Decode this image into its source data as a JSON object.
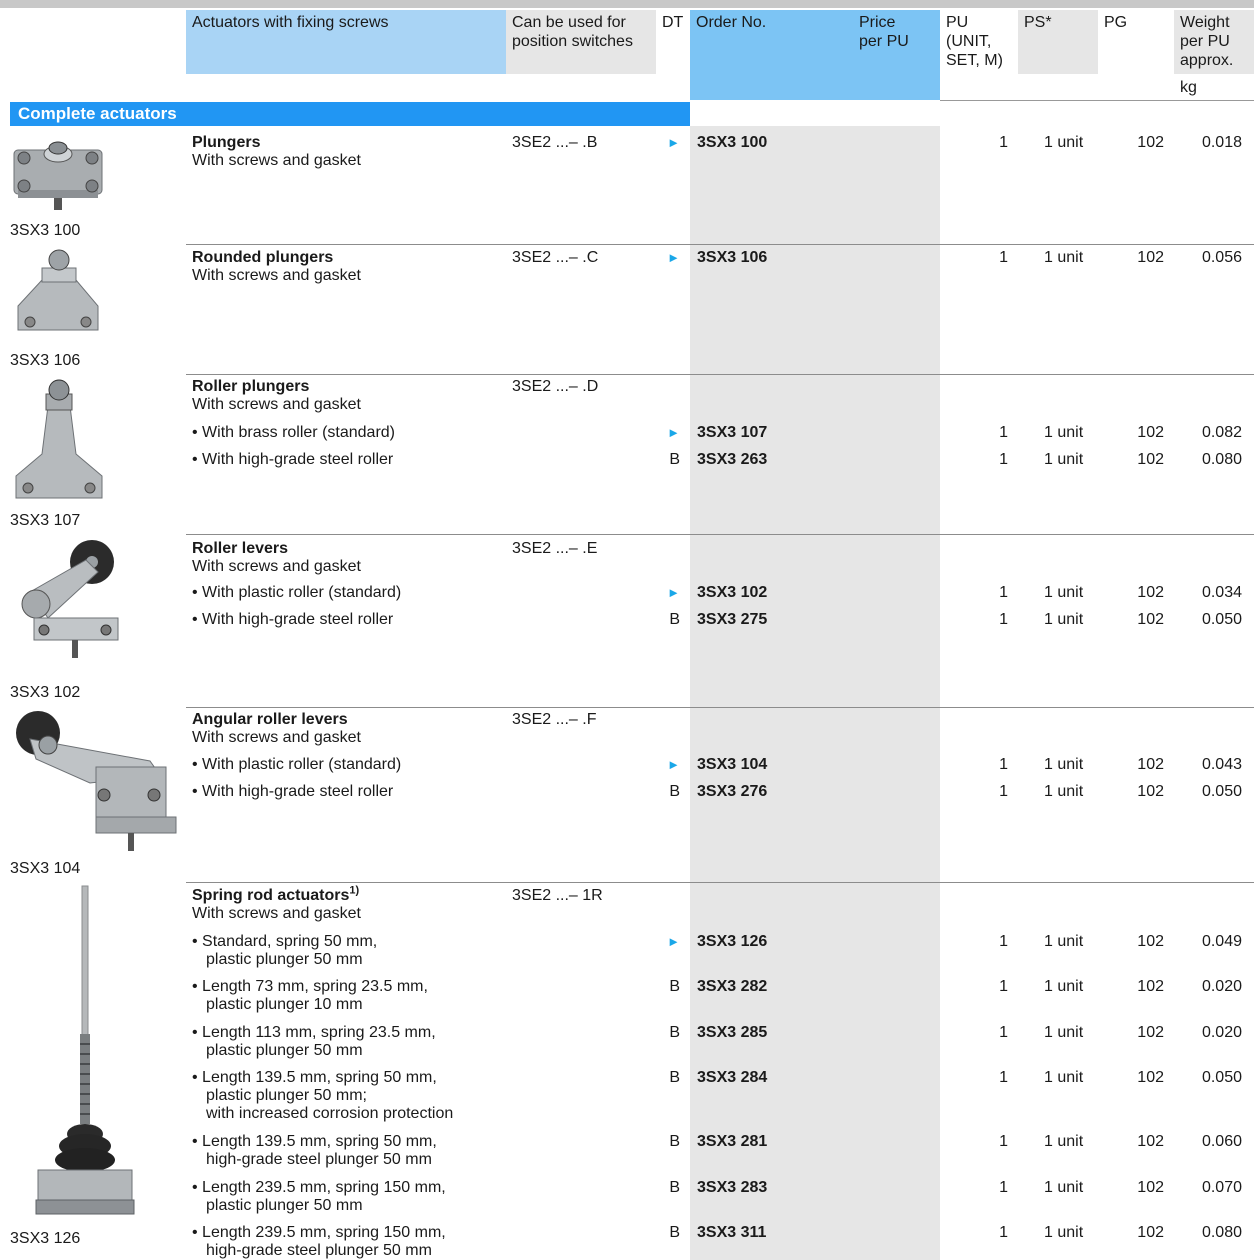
{
  "header": {
    "description": "Actuators with fixing screws",
    "can_be_used": "Can be used for\nposition switches",
    "dt": "DT",
    "order_no": "Order No.",
    "price": "Price\nper PU",
    "pu": "PU\n(UNIT,\nSET, M)",
    "ps": "PS*",
    "pg": "PG",
    "weight": "Weight\nper PU\napprox.",
    "weight_unit": "kg"
  },
  "section_title": "Complete actuators",
  "colors": {
    "header_blue": "#a9d4f5",
    "order_blue": "#7cc4f4",
    "section_blue": "#2196f3",
    "gray": "#e6e6e6",
    "triangle": "#1aa7e8"
  },
  "groups": [
    {
      "title": "Plungers",
      "subtitle": "With screws and gasket",
      "switch": "3SE2 ...– .B",
      "image_label": "3SX3 100",
      "image_icon": "plunger-actuator-icon",
      "items": [
        {
          "desc": "",
          "dt": "►",
          "order": "3SX3 100",
          "pu": "1",
          "ps": "1 unit",
          "pg": "102",
          "weight": "0.018"
        }
      ]
    },
    {
      "title": "Rounded plungers",
      "subtitle": "With screws and gasket",
      "switch": "3SE2 ...– .C",
      "image_label": "3SX3 106",
      "image_icon": "rounded-plunger-icon",
      "items": [
        {
          "desc": "",
          "dt": "►",
          "order": "3SX3 106",
          "pu": "1",
          "ps": "1 unit",
          "pg": "102",
          "weight": "0.056"
        }
      ]
    },
    {
      "title": "Roller plungers",
      "subtitle": "With screws and gasket",
      "switch": "3SE2 ...– .D",
      "image_label": "3SX3 107",
      "image_icon": "roller-plunger-icon",
      "items": [
        {
          "desc": "• With brass roller (standard)",
          "dt": "►",
          "order": "3SX3 107",
          "pu": "1",
          "ps": "1 unit",
          "pg": "102",
          "weight": "0.082"
        },
        {
          "desc": "• With high-grade steel roller",
          "dt": "B",
          "order": "3SX3 263",
          "pu": "1",
          "ps": "1 unit",
          "pg": "102",
          "weight": "0.080"
        }
      ]
    },
    {
      "title": "Roller levers",
      "subtitle": "With screws and gasket",
      "switch": "3SE2 ...– .E",
      "image_label": "3SX3 102",
      "image_icon": "roller-lever-icon",
      "items": [
        {
          "desc": "• With plastic roller (standard)",
          "dt": "►",
          "order": "3SX3 102",
          "pu": "1",
          "ps": "1 unit",
          "pg": "102",
          "weight": "0.034"
        },
        {
          "desc": "• With high-grade steel roller",
          "dt": "B",
          "order": "3SX3 275",
          "pu": "1",
          "ps": "1 unit",
          "pg": "102",
          "weight": "0.050"
        }
      ]
    },
    {
      "title": "Angular roller levers",
      "subtitle": "With screws and gasket",
      "switch": "3SE2 ...– .F",
      "image_label": "3SX3 104",
      "image_icon": "angular-roller-lever-icon",
      "items": [
        {
          "desc": "• With plastic roller (standard)",
          "dt": "►",
          "order": "3SX3 104",
          "pu": "1",
          "ps": "1 unit",
          "pg": "102",
          "weight": "0.043"
        },
        {
          "desc": "• With high-grade steel roller",
          "dt": "B",
          "order": "3SX3 276",
          "pu": "1",
          "ps": "1 unit",
          "pg": "102",
          "weight": "0.050"
        }
      ]
    },
    {
      "title": "Spring rod actuators",
      "footnote": "1)",
      "subtitle": "With screws and gasket",
      "switch": "3SE2 ...– 1R",
      "image_label": "3SX3 126",
      "image_icon": "spring-rod-actuator-icon",
      "items": [
        {
          "desc": "• Standard, spring 50 mm,\nplastic plunger 50 mm",
          "dt": "►",
          "order": "3SX3 126",
          "pu": "1",
          "ps": "1 unit",
          "pg": "102",
          "weight": "0.049"
        },
        {
          "desc": "• Length 73 mm, spring 23.5 mm,\nplastic plunger 10 mm",
          "dt": "B",
          "order": "3SX3 282",
          "pu": "1",
          "ps": "1 unit",
          "pg": "102",
          "weight": "0.020"
        },
        {
          "desc": "• Length 113 mm, spring 23.5 mm,\nplastic plunger 50 mm",
          "dt": "B",
          "order": "3SX3 285",
          "pu": "1",
          "ps": "1 unit",
          "pg": "102",
          "weight": "0.020"
        },
        {
          "desc": "• Length 139.5 mm, spring 50 mm,\nplastic plunger 50 mm;\nwith increased corrosion protection",
          "dt": "B",
          "order": "3SX3 284",
          "pu": "1",
          "ps": "1 unit",
          "pg": "102",
          "weight": "0.050"
        },
        {
          "desc": "• Length 139.5 mm, spring 50 mm,\nhigh-grade steel plunger 50 mm",
          "dt": "B",
          "order": "3SX3 281",
          "pu": "1",
          "ps": "1 unit",
          "pg": "102",
          "weight": "0.060"
        },
        {
          "desc": "• Length 239.5 mm, spring 150 mm,\nplastic plunger 50 mm",
          "dt": "B",
          "order": "3SX3 283",
          "pu": "1",
          "ps": "1 unit",
          "pg": "102",
          "weight": "0.070"
        },
        {
          "desc": "• Length 239.5 mm, spring 150 mm,\nhigh-grade steel plunger 50 mm",
          "dt": "B",
          "order": "3SX3 311",
          "pu": "1",
          "ps": "1 unit",
          "pg": "102",
          "weight": "0.080"
        }
      ]
    }
  ]
}
